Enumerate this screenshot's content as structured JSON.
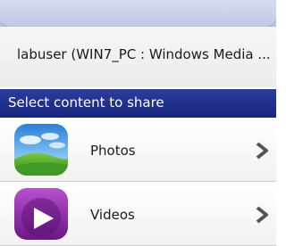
{
  "device": {
    "name": "labuser (WIN7_PC : Windows Media ..."
  },
  "section": {
    "title": "Select content to share"
  },
  "items": [
    {
      "label": "Photos",
      "icon": "photos-landscape-icon"
    },
    {
      "label": "Videos",
      "icon": "video-play-icon"
    }
  ],
  "colors": {
    "header_blue": "#17257e",
    "videos_purple": "#8a2aa3",
    "chevron": "#555555"
  }
}
